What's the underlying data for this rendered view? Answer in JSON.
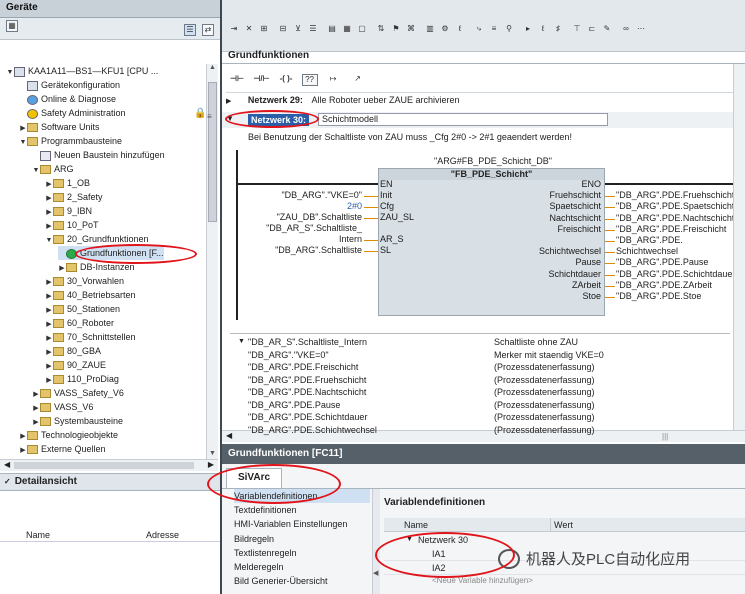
{
  "left_panel": {
    "title": "Geräte",
    "tree": [
      {
        "label": "KAA1A11—BS1—KFU1 [CPU ...",
        "indent": 0,
        "expand": "open",
        "icon": "cpu-icon"
      },
      {
        "label": "Gerätekonfiguration",
        "indent": 1,
        "expand": "",
        "icon": "device-config-icon"
      },
      {
        "label": "Online & Diagnose",
        "indent": 1,
        "expand": "",
        "icon": "online-diagnose-icon"
      },
      {
        "label": "Safety Administration",
        "indent": 1,
        "expand": "",
        "icon": "safety-icon"
      },
      {
        "label": "Software Units",
        "indent": 1,
        "expand": "closed",
        "icon": "folder-icon"
      },
      {
        "label": "Programmbausteine",
        "indent": 1,
        "expand": "open",
        "icon": "folder-icon"
      },
      {
        "label": "Neuen Baustein hinzufügen",
        "indent": 2,
        "expand": "",
        "icon": "add-block-icon"
      },
      {
        "label": "ARG",
        "indent": 2,
        "expand": "open",
        "icon": "folder-icon"
      },
      {
        "label": "1_OB",
        "indent": 3,
        "expand": "closed",
        "icon": "folder-icon"
      },
      {
        "label": "2_Safety",
        "indent": 3,
        "expand": "closed",
        "icon": "folder-icon"
      },
      {
        "label": "9_IBN",
        "indent": 3,
        "expand": "closed",
        "icon": "folder-icon"
      },
      {
        "label": "10_PoT",
        "indent": 3,
        "expand": "closed",
        "icon": "folder-icon"
      },
      {
        "label": "20_Grundfunktionen",
        "indent": 3,
        "expand": "open",
        "icon": "folder-icon"
      },
      {
        "label": "Grundfunktionen [F...",
        "indent": 4,
        "expand": "",
        "icon": "fc-block-icon"
      },
      {
        "label": "DB-Instanzen",
        "indent": 4,
        "expand": "closed",
        "icon": "folder-icon"
      },
      {
        "label": "30_Vorwahlen",
        "indent": 3,
        "expand": "closed",
        "icon": "folder-icon"
      },
      {
        "label": "40_Betriebsarten",
        "indent": 3,
        "expand": "closed",
        "icon": "folder-icon"
      },
      {
        "label": "50_Stationen",
        "indent": 3,
        "expand": "closed",
        "icon": "folder-icon"
      },
      {
        "label": "60_Roboter",
        "indent": 3,
        "expand": "closed",
        "icon": "folder-icon"
      },
      {
        "label": "70_Schnittstellen",
        "indent": 3,
        "expand": "closed",
        "icon": "folder-icon"
      },
      {
        "label": "80_GBA",
        "indent": 3,
        "expand": "closed",
        "icon": "folder-icon"
      },
      {
        "label": "90_ZAUE",
        "indent": 3,
        "expand": "closed",
        "icon": "folder-icon"
      },
      {
        "label": "110_ProDiag",
        "indent": 3,
        "expand": "closed",
        "icon": "folder-icon"
      },
      {
        "label": "VASS_Safety_V6",
        "indent": 2,
        "expand": "closed",
        "icon": "folder-icon"
      },
      {
        "label": "VASS_V6",
        "indent": 2,
        "expand": "closed",
        "icon": "folder-icon"
      },
      {
        "label": "Systembausteine",
        "indent": 2,
        "expand": "closed",
        "icon": "folder-icon"
      },
      {
        "label": "Technologieobjekte",
        "indent": 1,
        "expand": "closed",
        "icon": "folder-icon"
      },
      {
        "label": "Externe Quellen",
        "indent": 1,
        "expand": "closed",
        "icon": "folder-icon"
      }
    ],
    "detail_title": "Detailansicht",
    "detail_columns": [
      "Name",
      "Adresse"
    ]
  },
  "editor": {
    "title": "Grundfunktionen",
    "network29_label": "Netzwerk 29:",
    "network29_comment": "Alle Roboter ueber ZAUE archivieren",
    "network30_label": "Netzwerk 30:",
    "network30_title": "Schichtmodell",
    "network30_comment": "Bei Benutzung der Schaltliste von ZAU muss _Cfg 2#0 -> 2#1 geaendert werden!",
    "instance_db": "\"ARG#FB_PDE_Schicht_DB\"",
    "fb_name": "\"FB_PDE_Schicht\"",
    "inputs": [
      {
        "actual": "",
        "pin": "EN"
      },
      {
        "actual": "\"DB_ARG\".\"VKE=0\"",
        "pin": "Init"
      },
      {
        "actual": "2#0",
        "pin": "Cfg"
      },
      {
        "actual": "\"ZAU_DB\".Schaltliste",
        "pin": "ZAU_SL"
      },
      {
        "actual": "\"DB_AR_S\".Schaltliste_",
        "pin": ""
      },
      {
        "actual": "Intern",
        "pin": "AR_S"
      },
      {
        "actual": "\"DB_ARG\".Schaltliste",
        "pin": "SL"
      }
    ],
    "outputs": [
      {
        "pin": "ENO",
        "actual": ""
      },
      {
        "pin": "Fruehschicht",
        "actual": "\"DB_ARG\".PDE.Fruehschicht"
      },
      {
        "pin": "Spaetschicht",
        "actual": "\"DB_ARG\".PDE.Spaetschicht"
      },
      {
        "pin": "Nachtschicht",
        "actual": "\"DB_ARG\".PDE.Nachtschicht"
      },
      {
        "pin": "Freischicht",
        "actual": "\"DB_ARG\".PDE.Freischicht"
      },
      {
        "pin": "",
        "actual": "\"DB_ARG\".PDE."
      },
      {
        "pin": "Schichtwechsel",
        "actual": "Schichtwechsel"
      },
      {
        "pin": "Pause",
        "actual": "\"DB_ARG\".PDE.Pause"
      },
      {
        "pin": "Schichtdauer",
        "actual": "\"DB_ARG\".PDE.Schichtdauer"
      },
      {
        "pin": "ZArbeit",
        "actual": "\"DB_ARG\".PDE.ZArbeit"
      },
      {
        "pin": "Stoe",
        "actual": "\"DB_ARG\".PDE.Stoe"
      }
    ],
    "symbol_rows": [
      {
        "name": "\"DB_AR_S\".Schaltliste_Intern",
        "comment": "Schaltliste ohne ZAU"
      },
      {
        "name": "\"DB_ARG\".\"VKE=0\"",
        "comment": "Merker mit staendig VKE=0"
      },
      {
        "name": "\"DB_ARG\".PDE.Freischicht",
        "comment": "(Prozessdatenerfassung)"
      },
      {
        "name": "\"DB_ARG\".PDE.Fruehschicht",
        "comment": "(Prozessdatenerfassung)"
      },
      {
        "name": "\"DB_ARG\".PDE.Nachtschicht",
        "comment": "(Prozessdatenerfassung)"
      },
      {
        "name": "\"DB_ARG\".PDE.Pause",
        "comment": "(Prozessdatenerfassung)"
      },
      {
        "name": "\"DB_ARG\".PDE.Schichtdauer",
        "comment": "(Prozessdatenerfassung)"
      },
      {
        "name": "\"DB_ARG\".PDE.Schichtwechsel",
        "comment": "(Prozessdatenerfassung)"
      }
    ]
  },
  "bottom": {
    "title": "Grundfunktionen [FC11]",
    "tab": "SiVArc",
    "nav": [
      "Variablendefinitionen",
      "Textdefinitionen",
      "HMI-Variablen Einstellungen",
      "Bildregeln",
      "Textlistenregeln",
      "Melderegeln",
      "Bild Generier-Übersicht"
    ],
    "section_title": "Variablendefinitionen",
    "columns": [
      "Name",
      "Wert"
    ],
    "group": "Netzwerk 30",
    "vars": [
      "IA1",
      "IA2"
    ],
    "add_placeholder": "<Neue Variable hinzufügen>"
  },
  "watermark": "机器人及PLC自动化应用",
  "colors": {
    "highlight": "#2a5fa8",
    "annotation_red": "#e0141a",
    "fb_box": "#d8dfe5"
  }
}
